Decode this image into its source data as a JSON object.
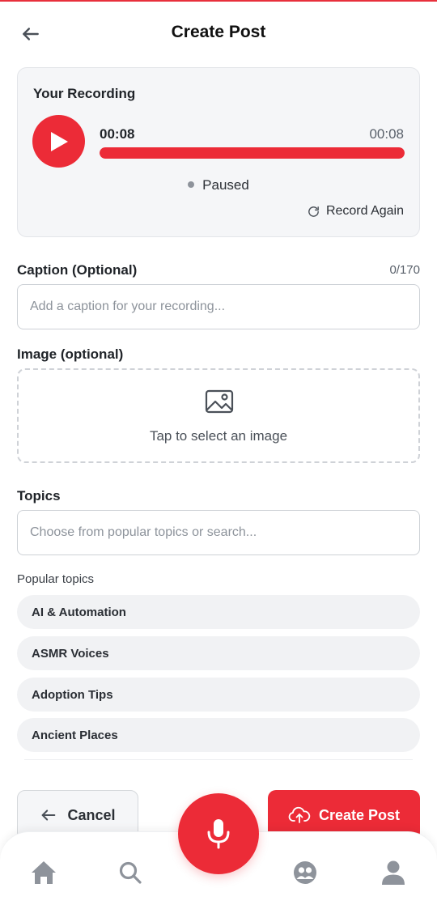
{
  "header": {
    "title": "Create Post",
    "back_icon": "arrow-left-icon"
  },
  "recording": {
    "title": "Your Recording",
    "current_time": "00:08",
    "total_time": "00:08",
    "progress": 1.0,
    "status": "Paused",
    "record_again_label": "Record Again"
  },
  "caption": {
    "label": "Caption (Optional)",
    "counter": "0/170",
    "value": "",
    "placeholder": "Add a caption for your recording..."
  },
  "image": {
    "label": "Image (optional)",
    "prompt": "Tap to select an image"
  },
  "topics": {
    "label": "Topics",
    "value": "",
    "placeholder": "Choose from popular topics or search...",
    "popular_label": "Popular topics",
    "popular": [
      {
        "label": "AI & Automation"
      },
      {
        "label": "ASMR Voices"
      },
      {
        "label": "Adoption Tips"
      },
      {
        "label": "Ancient Places"
      }
    ]
  },
  "actions": {
    "cancel_label": "Cancel",
    "create_label": "Create Post"
  },
  "bottom_nav": {
    "items": [
      "home-icon",
      "search-icon",
      "microphone-icon",
      "community-icon",
      "profile-icon"
    ]
  },
  "colors": {
    "accent": "#ec2b37",
    "card_bg": "#f5f6f8",
    "chip_bg": "#f1f2f4",
    "nav_icon": "#8e939b"
  }
}
